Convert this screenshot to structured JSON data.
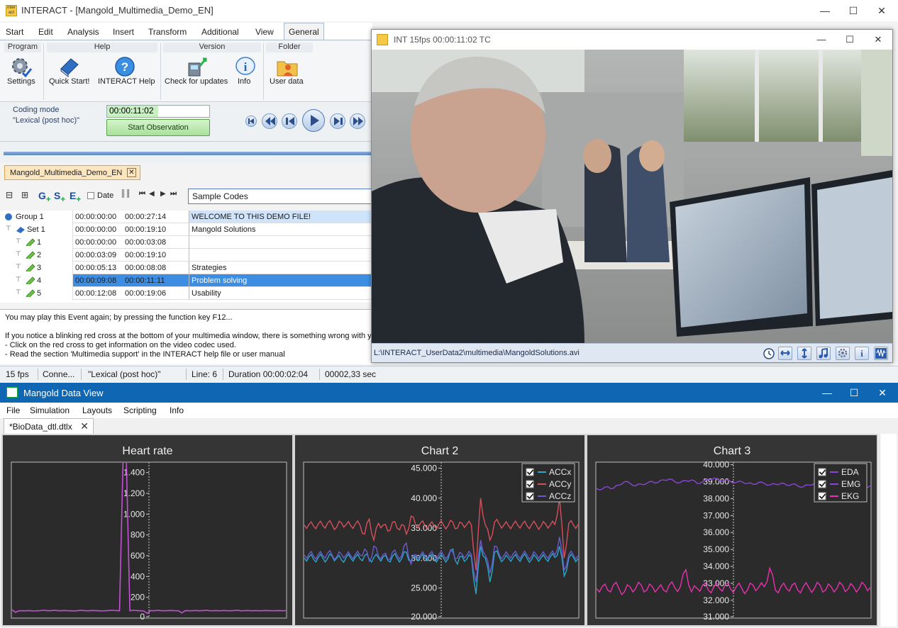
{
  "interact": {
    "title": "INTERACT - [Mangold_Multimedia_Demo_EN]",
    "logo_text": "inter act",
    "menu": [
      "Start",
      "Edit",
      "Analysis",
      "Insert",
      "Transform",
      "Additional",
      "View",
      "General"
    ],
    "active_menu": "General",
    "ribbon": {
      "groups": {
        "program": "Program",
        "help": "Help",
        "version": "Version",
        "folder": "Folder"
      },
      "buttons": {
        "settings": "Settings",
        "quick_start": "Quick Start!",
        "interact_help": "INTERACT Help",
        "check_updates": "Check for updates",
        "info": "Info",
        "user_data": "User data"
      }
    },
    "coding": {
      "mode_label": "Coding mode",
      "mode_value": "\"Lexical (post hoc)\"",
      "timecode": "00:00:11:02",
      "start_button": "Start Observation"
    },
    "doc_tab": "Mangold_Multimedia_Demo_EN",
    "tree_toolbar": {
      "g": "G",
      "s": "S",
      "e": "E",
      "date_label": "Date"
    },
    "sample_codes": "Sample Codes",
    "tree_rows": [
      {
        "name": "Group 1",
        "start": "00:00:00:00",
        "end": "00:00:27:14",
        "code": "WELCOME TO THIS DEMO FILE!",
        "level": 0,
        "kind": "group"
      },
      {
        "name": "Set 1",
        "start": "00:00:00:00",
        "end": "00:00:19:10",
        "code": "Mangold Solutions",
        "level": 1,
        "kind": "set"
      },
      {
        "name": "1",
        "start": "00:00:00:00",
        "end": "00:00:03:08",
        "code": "",
        "level": 2,
        "kind": "event"
      },
      {
        "name": "2",
        "start": "00:00:03:09",
        "end": "00:00:19:10",
        "code": "",
        "level": 2,
        "kind": "event"
      },
      {
        "name": "3",
        "start": "00:00:05:13",
        "end": "00:00:08:08",
        "code": "Strategies",
        "level": 2,
        "kind": "event"
      },
      {
        "name": "4",
        "start": "00:00:09:08",
        "end": "00:00:11:11",
        "code": "Problem solving",
        "level": 2,
        "kind": "event",
        "selected": true
      },
      {
        "name": "5",
        "start": "00:00:12:08",
        "end": "00:00:19:06",
        "code": "Usability",
        "level": 2,
        "kind": "event"
      }
    ],
    "info_lines": [
      "You may play this Event again; by pressing the function key F12...",
      "",
      "If you notice a blinking red cross at the bottom of your multimedia window, there is something wrong with y",
      "- Click on the red cross to get information on the video codec used.",
      "- Read the section 'Multimedia support' in the INTERACT help file or user manual"
    ],
    "status": {
      "fps": "15 fps",
      "conn": "Conne...",
      "mode": "\"Lexical (post hoc)\"",
      "line": "Line: 6",
      "duration": "Duration 00:00:02:04",
      "seconds": "00002,33 sec"
    }
  },
  "video_window": {
    "title": "INT 15fps   00:00:11:02 TC",
    "path": "L:\\INTERACT_UserData2\\multimedia\\MangoldSolutions.avi"
  },
  "data_view": {
    "title": "Mangold Data View",
    "menu": [
      "File",
      "Simulation",
      "Layouts",
      "Scripting",
      "Info"
    ],
    "tab": "*BioData_dtl.dtlx",
    "colors": {
      "panel_bg": "#353535",
      "heart": "#c64fd8",
      "accx": "#2aa7c6",
      "accy": "#d5505b",
      "accz": "#6a5ad0",
      "eda": "#8b44d8",
      "emg": "#8b44d8",
      "ekg": "#e830b0"
    }
  },
  "chart_data": [
    {
      "type": "line",
      "title": "Heart rate",
      "yticks": [
        "1.400",
        "1.200",
        "1.000",
        "800",
        "600",
        "400",
        "200",
        "0"
      ],
      "ylim": [
        0,
        1500
      ],
      "grid": "vertical-center",
      "series": [
        {
          "values": [
            80,
            55,
            70,
            70,
            70,
            72,
            68,
            70,
            71,
            75,
            72,
            70,
            74,
            72,
            70,
            73,
            71,
            70,
            69,
            72,
            74,
            71,
            70,
            73,
            72,
            70,
            68,
            71,
            73,
            75,
            72,
            70,
            1500,
            1500,
            70,
            75,
            72,
            70,
            68,
            45,
            72,
            70,
            74,
            71,
            70,
            72,
            73,
            71,
            70,
            50,
            72,
            70,
            71,
            73,
            70,
            72,
            74,
            71,
            70,
            72,
            70,
            73,
            71,
            70,
            72,
            74,
            70,
            71,
            73,
            70,
            72,
            71,
            70,
            73,
            72,
            70,
            71,
            72,
            70,
            72
          ]
        }
      ]
    },
    {
      "type": "line",
      "title": "Chart 2",
      "yticks": [
        "45.000",
        "40.000",
        "35.000",
        "30.000",
        "25.000",
        "20.000"
      ],
      "ylim": [
        20000,
        46000
      ],
      "legend": "top-right",
      "series": [
        {
          "name": "ACCx",
          "values": [
            30000,
            30200,
            29800,
            30100,
            30000,
            29900,
            30300,
            30000,
            29700,
            30100,
            30000,
            30200,
            29900,
            30400,
            29800,
            30100,
            30000,
            30200,
            29600,
            30300,
            30000,
            29900,
            31000,
            29500,
            30200,
            30100,
            30000,
            30300,
            29800,
            30100,
            30000,
            29900,
            31500,
            29000,
            30300,
            29800,
            30200,
            24000,
            32000,
            30000,
            26000,
            31000,
            30200,
            29800,
            30000,
            30100,
            29900,
            30200,
            30000,
            29800,
            30100,
            30000,
            29900,
            30200,
            30100,
            32000,
            27000,
            30000,
            30100,
            29900
          ]
        },
        {
          "name": "ACCy",
          "values": [
            35500,
            35600,
            35300,
            35700,
            35400,
            35800,
            35500,
            35200,
            35900,
            35600,
            35400,
            35700,
            35500,
            34000,
            36500,
            33000,
            35800,
            35500,
            34500,
            36000,
            35000,
            35600,
            34000,
            37000,
            35500,
            35800,
            35400,
            35600,
            35300,
            35700,
            35500,
            35400,
            36000,
            35000,
            35800,
            35600,
            35500,
            28000,
            40000,
            35500,
            33000,
            36000,
            35700,
            35500,
            35400,
            35600,
            35500,
            35700,
            35400,
            35600,
            35500,
            35300,
            35700,
            35500,
            35600,
            40000,
            30000,
            35800,
            35500,
            35600
          ]
        },
        {
          "name": "ACCz",
          "values": [
            30500,
            30700,
            30300,
            30600,
            30400,
            30800,
            30500,
            30200,
            30700,
            30500,
            30400,
            30600,
            30500,
            31500,
            29500,
            32000,
            30300,
            30600,
            29800,
            31000,
            30500,
            30400,
            32500,
            29000,
            30600,
            30500,
            30400,
            30700,
            30300,
            30600,
            30500,
            30400,
            31000,
            30000,
            30700,
            30500,
            30600,
            26000,
            33000,
            30500,
            27500,
            32000,
            30600,
            30400,
            30500,
            30700,
            30400,
            30600,
            30500,
            30300,
            30600,
            30500,
            30400,
            30700,
            30500,
            33500,
            28000,
            30600,
            30500,
            30400
          ]
        }
      ]
    },
    {
      "type": "line",
      "title": "Chart 3",
      "yticks": [
        "40.000",
        "39.000",
        "38.000",
        "37.000",
        "36.000",
        "35.000",
        "34.000",
        "33.000",
        "32.000",
        "31.000"
      ],
      "ylim": [
        30950,
        40150
      ],
      "legend": "top-right",
      "series": [
        {
          "name": "EDA",
          "values": [
            38600,
            38550,
            38700,
            38600,
            38800,
            39000,
            38900,
            38750,
            38850,
            38900,
            39000,
            38950,
            39100,
            39150,
            39000,
            38950,
            39050,
            39100,
            38900,
            39000,
            39150,
            39200,
            39050,
            39100,
            39000,
            38950,
            39000,
            38900,
            38850,
            38950,
            38900,
            38800,
            38850,
            38900,
            38800,
            38850,
            38750,
            38700,
            38800,
            38900,
            38800,
            38750,
            39100,
            38850,
            38750,
            38800,
            38900,
            38850,
            38700,
            38750
          ]
        },
        {
          "name": "EMG",
          "values": []
        },
        {
          "name": "EKG",
          "values": [
            32700,
            32800,
            32600,
            32900,
            32700,
            32500,
            32800,
            32700,
            32900,
            32600,
            32800,
            32700,
            32600,
            32900,
            32750,
            32800,
            33800,
            32500,
            32700,
            32900,
            32600,
            32800,
            32700,
            32900,
            32650,
            32800,
            32700,
            32600,
            32900,
            32750,
            32800,
            33900,
            32600,
            32800,
            32700,
            32900,
            32600,
            32800,
            32750,
            32700,
            32900,
            32600,
            32800,
            32700,
            32900,
            32650,
            32800,
            32700,
            32900,
            32750
          ]
        }
      ]
    }
  ]
}
